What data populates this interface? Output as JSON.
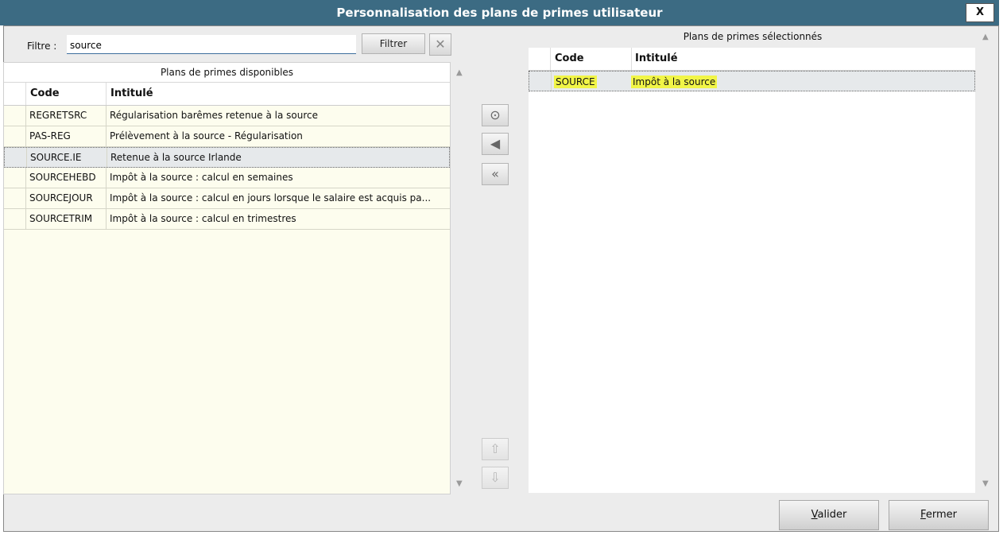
{
  "window": {
    "title": "Personnalisation des plans de primes utilisateur",
    "close_label": "X"
  },
  "filter": {
    "label": "Filtre :",
    "value": "source",
    "button_label": "Filtrer",
    "clear_label": "✕"
  },
  "available": {
    "title": "Plans de primes disponibles",
    "col_code": "Code",
    "col_label": "Intitulé",
    "rows": [
      {
        "code": "REGRETSRC",
        "label": "Régularisation barêmes retenue à la source"
      },
      {
        "code": "PAS-REG",
        "label": "Prélèvement à la source - Régularisation"
      },
      {
        "code": "SOURCE.IE",
        "label": "Retenue à la source Irlande"
      },
      {
        "code": "SOURCEHEBD",
        "label": "Impôt à la source : calcul en semaines"
      },
      {
        "code": "SOURCEJOUR",
        "label": "Impôt à la source : calcul en jours lorsque le salaire est acquis pa..."
      },
      {
        "code": "SOURCETRIM",
        "label": "Impôt à la source : calcul en trimestres"
      }
    ],
    "selected_index": 2
  },
  "selected": {
    "title": "Plans de primes sélectionnés",
    "col_code": "Code",
    "col_label": "Intitulé",
    "rows": [
      {
        "code": "SOURCE",
        "label": "Impôt à la source"
      }
    ]
  },
  "transfer_buttons": {
    "add": "⊙",
    "remove": "◀",
    "remove_all": "«",
    "move_up": "⇧",
    "move_down": "⇩"
  },
  "footer": {
    "validate_prefix": "",
    "validate_underline": "V",
    "validate_rest": "alider",
    "close_underline": "F",
    "close_rest": "ermer"
  },
  "colors": {
    "titlebar": "#3c6b83",
    "highlight": "#f1f547",
    "row_bg": "#fdfdee"
  }
}
